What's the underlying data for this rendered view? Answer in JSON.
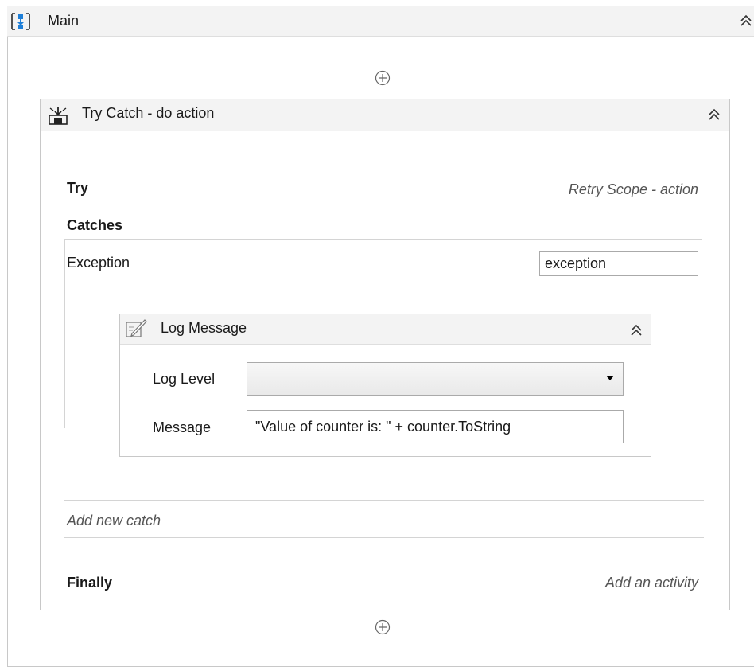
{
  "main": {
    "title": "Main"
  },
  "try_catch": {
    "title": "Try Catch - do action",
    "try_label": "Try",
    "try_activity": "Retry Scope - action",
    "catches_label": "Catches",
    "exception_label": "Exception",
    "exception_value": "exception",
    "log_message": {
      "title": "Log Message",
      "log_level_label": "Log Level",
      "log_level_value": "",
      "message_label": "Message",
      "message_value": "\"Value of counter is: \" + counter.ToString"
    },
    "add_catch_label": "Add new catch",
    "finally_label": "Finally",
    "finally_activity": "Add an activity"
  },
  "icons": {
    "main": "sequence-icon",
    "try_catch": "try-catch-icon",
    "log_message": "log-message-icon",
    "collapse": "double-chevron-up-icon",
    "add": "add-circle-icon"
  }
}
